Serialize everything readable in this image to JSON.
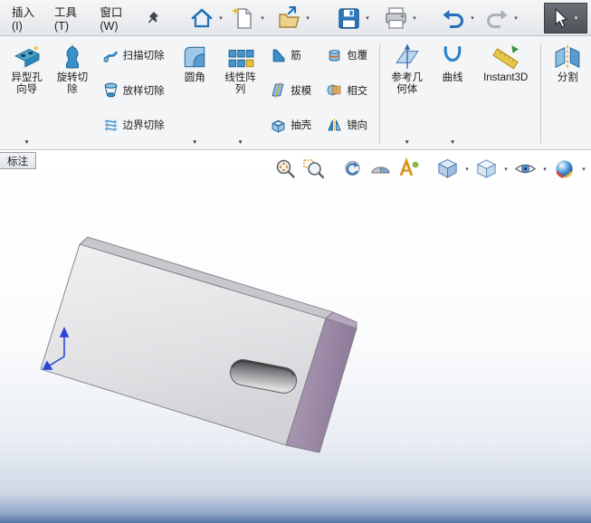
{
  "menubar": {
    "insert": "插入(I)",
    "tools": "工具(T)",
    "window": "窗口(W)"
  },
  "quick_access": {
    "icons": [
      "home-icon",
      "new-document-icon",
      "open-icon",
      "save-icon",
      "print-icon",
      "undo-icon",
      "redo-icon",
      "select-cursor-icon"
    ]
  },
  "ribbon": {
    "hole_wizard": "异型孔向导",
    "revolved_cut": "旋转切除",
    "swept_cut": "扫描切除",
    "lofted_cut": "放样切除",
    "boundary_cut": "边界切除",
    "fillet": "圆角",
    "linear_pattern": "线性阵列",
    "rib": "筋",
    "draft": "拔模",
    "shell": "抽壳",
    "wrap": "包覆",
    "intersect": "相交",
    "mirror": "镜向",
    "reference_geometry": "参考几何体",
    "curves": "曲线",
    "instant3d": "Instant3D",
    "split": "分割"
  },
  "tab_bar": {
    "annotation_tab": "标注"
  },
  "view_toolbar": {
    "icons": [
      "zoom-to-fit-icon",
      "zoom-to-area-icon",
      "previous-view-icon",
      "section-view-icon",
      "annotation-views-icon",
      "view-orientation-icon",
      "display-style-icon",
      "hide-show-items-icon",
      "edit-appearance-icon"
    ]
  },
  "icons": {
    "dropdown_arrow": "▼",
    "dropdown_arrow_small": "▾"
  },
  "colors": {
    "accent_blue": "#2470b8",
    "part_face_gray": "#e4e4e6",
    "part_end_purple": "#9c89a6",
    "viewport_bottom_blue": "#5272a2"
  }
}
